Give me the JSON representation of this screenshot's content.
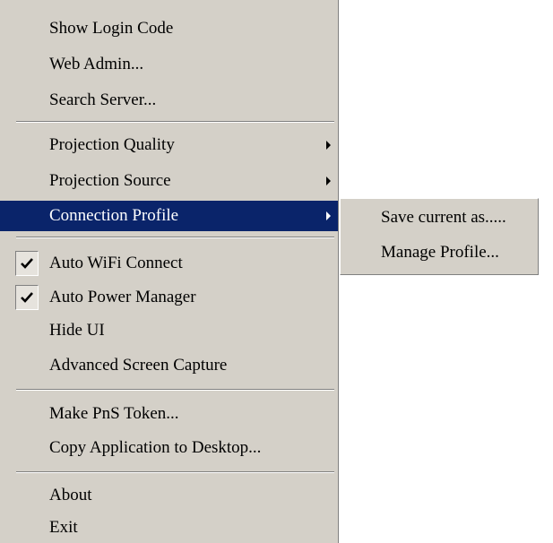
{
  "menu": {
    "group1": [
      {
        "label": "Show Login Code"
      },
      {
        "label": "Web Admin..."
      },
      {
        "label": "Search Server..."
      }
    ],
    "group2": [
      {
        "label": "Projection Quality"
      },
      {
        "label": "Projection Source"
      },
      {
        "label": "Connection Profile"
      }
    ],
    "group3": [
      {
        "label": "Auto WiFi Connect",
        "checked": true
      },
      {
        "label": "Auto Power Manager",
        "checked": true
      },
      {
        "label": "Hide UI"
      },
      {
        "label": "Advanced Screen Capture"
      }
    ],
    "group4": [
      {
        "label": "Make PnS Token..."
      },
      {
        "label": "Copy Application to Desktop..."
      }
    ],
    "group5": [
      {
        "label": "About"
      },
      {
        "label": "Exit"
      }
    ]
  },
  "submenu": {
    "items": [
      {
        "label": "Save current as....."
      },
      {
        "label": "Manage Profile..."
      }
    ]
  },
  "colors": {
    "menu_background": "#d4d0c8",
    "highlight_background": "#0a246a",
    "highlight_text": "#ffffff"
  },
  "icons": {
    "submenu_arrow": "submenu-arrow-icon",
    "check": "check-icon"
  }
}
